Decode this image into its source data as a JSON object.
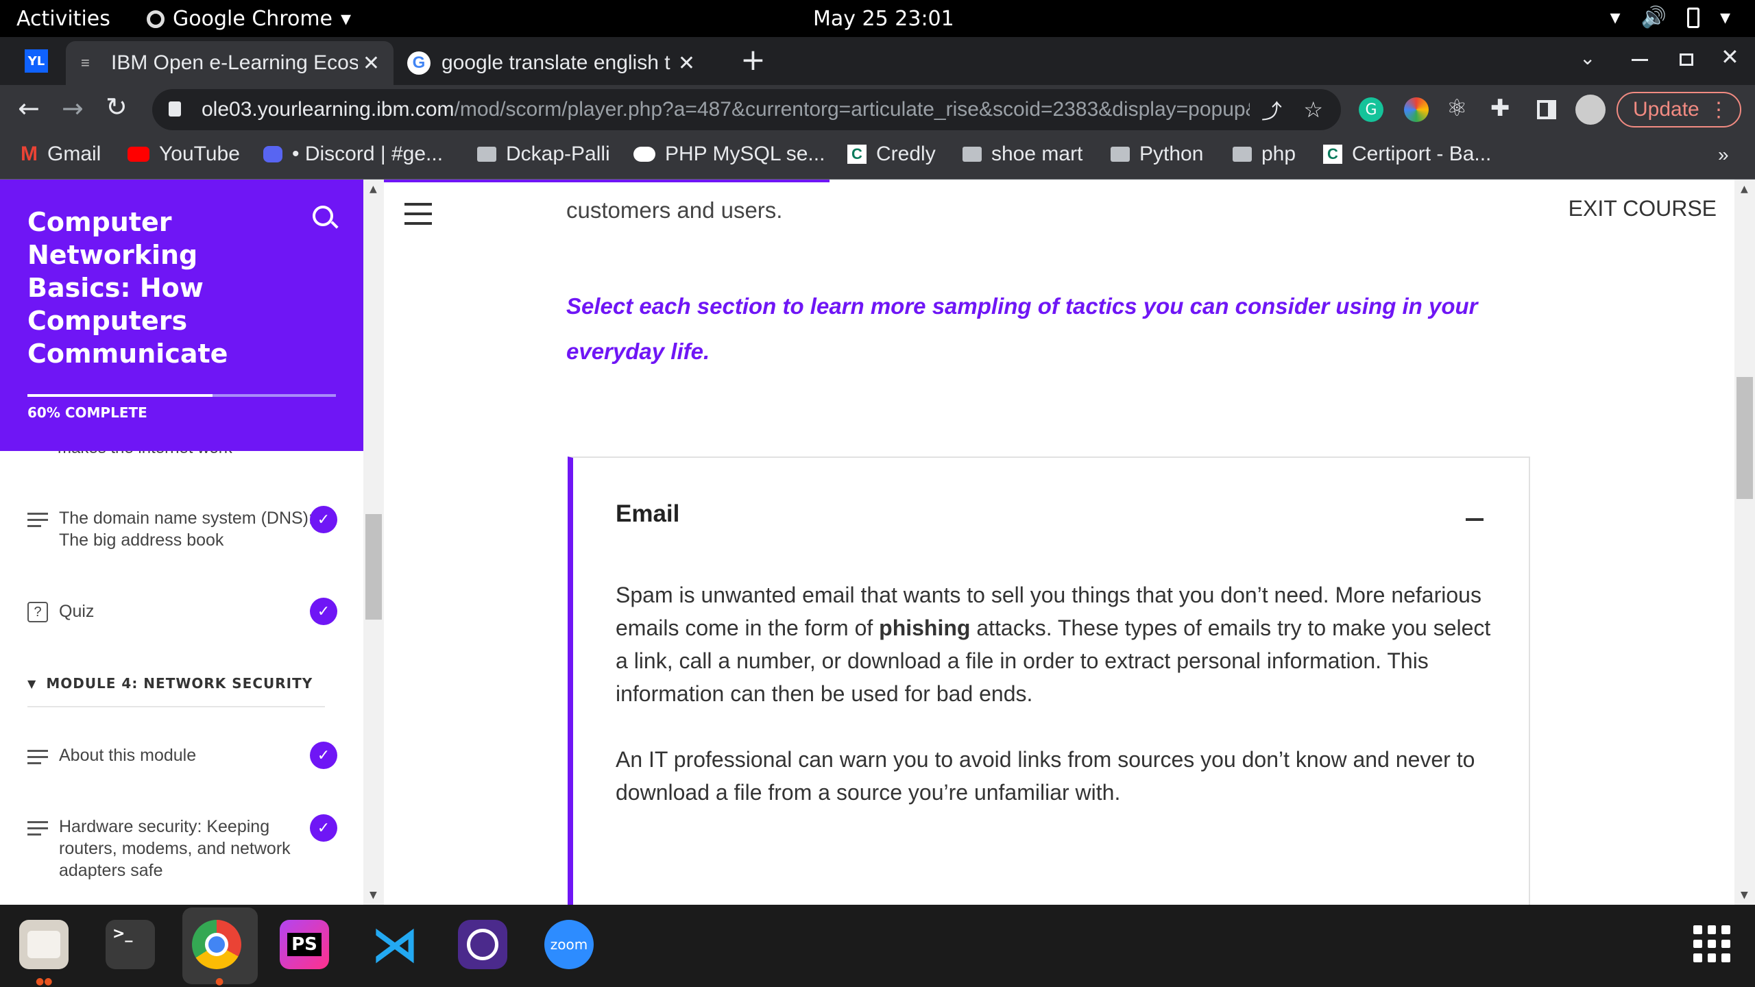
{
  "system": {
    "activities": "Activities",
    "app_name": "Google Chrome",
    "clock": "May 25  23:01"
  },
  "tabs": [
    {
      "title": "IBM Open e-Learning Ecos",
      "active": true
    },
    {
      "title": "google translate english t",
      "active": false
    }
  ],
  "address": {
    "host": "ole03.yourlearning.ibm.com",
    "path": "/mod/scorm/player.php?a=487&currentorg=articulate_rise&scoid=2383&display=popup&..."
  },
  "update_label": "Update",
  "bookmarks": [
    "Gmail",
    "YouTube",
    "• Discord | #ge...",
    "Dckap-Palli",
    "PHP MySQL se...",
    "Credly",
    "shoe mart",
    "Python",
    "php",
    "Certiport - Ba..."
  ],
  "bookmarks_overflow": "»",
  "course": {
    "title": "Computer Networking Basics: How Computers Communicate",
    "progress_label": "60% COMPLETE",
    "progress_fraction": 0.6,
    "cut_lesson": "makes the internet work",
    "lessons_top": [
      {
        "label": "The domain name system (DNS): The big address book",
        "icon": "lines-icon",
        "done": true
      },
      {
        "label": "Quiz",
        "icon": "quiz-icon",
        "done": true
      }
    ],
    "module_label": "MODULE 4: NETWORK SECURITY",
    "lessons_module": [
      {
        "label": "About this module",
        "icon": "lines-icon",
        "done": true
      },
      {
        "label": "Hardware security: Keeping routers, modems, and network adapters safe",
        "icon": "lines-icon",
        "done": true
      }
    ]
  },
  "content": {
    "exit_label": "EXIT COURSE",
    "intro_tail": "customers and users.",
    "prompt": "Select each section to learn more sampling of tactics you can consider using in your everyday life.",
    "accordion": {
      "title": "Email",
      "p1_before": "Spam is unwanted email that wants to sell you things that you don’t need. More nefarious emails come in the form of ",
      "p1_bold": "phishing",
      "p1_after": " attacks. These types of emails try to make you select a link, call a number, or download a file in order to extract personal information. This information can then be used for bad ends.",
      "p2": "An IT professional can warn you to avoid links from sources you don’t know and never to download a file from a source you’re unfamiliar with."
    }
  },
  "dock_apps": [
    "files-icon",
    "terminal-icon",
    "chrome-icon",
    "phpstorm-icon",
    "vscode-icon",
    "screenshot-icon",
    "zoom-icon"
  ],
  "dock_labels": {
    "phpstorm": "PS",
    "zoom": "zoom"
  },
  "colors": {
    "accent": "#6f16f5"
  }
}
